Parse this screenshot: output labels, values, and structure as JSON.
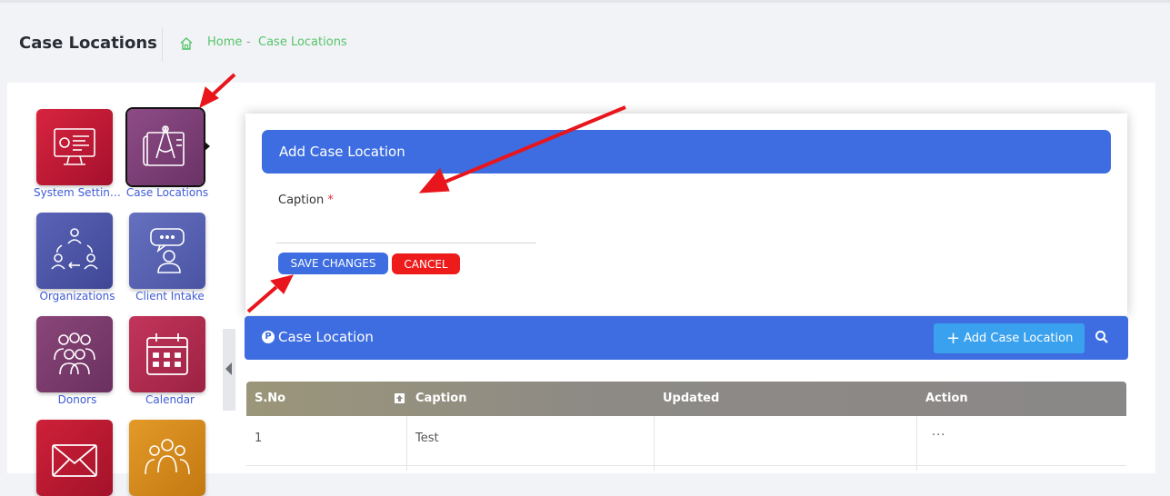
{
  "header": {
    "title": "Case Locations",
    "breadcrumb": {
      "home": "Home",
      "separator": "-",
      "current": "Case Locations"
    }
  },
  "modules": [
    {
      "label": "System Settings",
      "icon": "monitor-settings-icon",
      "color": "#c8193a"
    },
    {
      "label": "Case Locations",
      "icon": "blueprint-icon",
      "color": "#7d3f74"
    },
    {
      "label": "Organizations",
      "icon": "organization-cycle-icon",
      "color": "#4f56a6"
    },
    {
      "label": "Client Intake",
      "icon": "client-chat-icon",
      "color": "#5560b0"
    },
    {
      "label": "Donors",
      "icon": "donors-group-icon",
      "color": "#7c3b6c"
    },
    {
      "label": "Calendar",
      "icon": "calendar-icon",
      "color": "#b12b4d"
    },
    {
      "label": "",
      "icon": "mail-icon",
      "color": "#c21b33"
    },
    {
      "label": "",
      "icon": "team-icon",
      "color": "#d98c1c"
    }
  ],
  "modal": {
    "title": "Add Case Location",
    "caption_label": "Caption",
    "required_mark": "*",
    "caption_value": "",
    "save_label": "SAVE CHANGES",
    "cancel_label": "CANCEL"
  },
  "list": {
    "icon_letter": "P",
    "title": "Case Location",
    "add_label": "Add Case Location"
  },
  "table": {
    "columns": [
      "S.No",
      "Caption",
      "Updated",
      "Action"
    ],
    "rows": [
      {
        "sno": "1",
        "caption": "Test",
        "updated": "",
        "action": "···"
      }
    ]
  },
  "colors": {
    "primary": "#3d6de0",
    "danger": "#ee1b1b",
    "accent_add": "#3aa1ee",
    "breadcrumb": "#55c46a",
    "tile_label": "#3f5bd6"
  }
}
